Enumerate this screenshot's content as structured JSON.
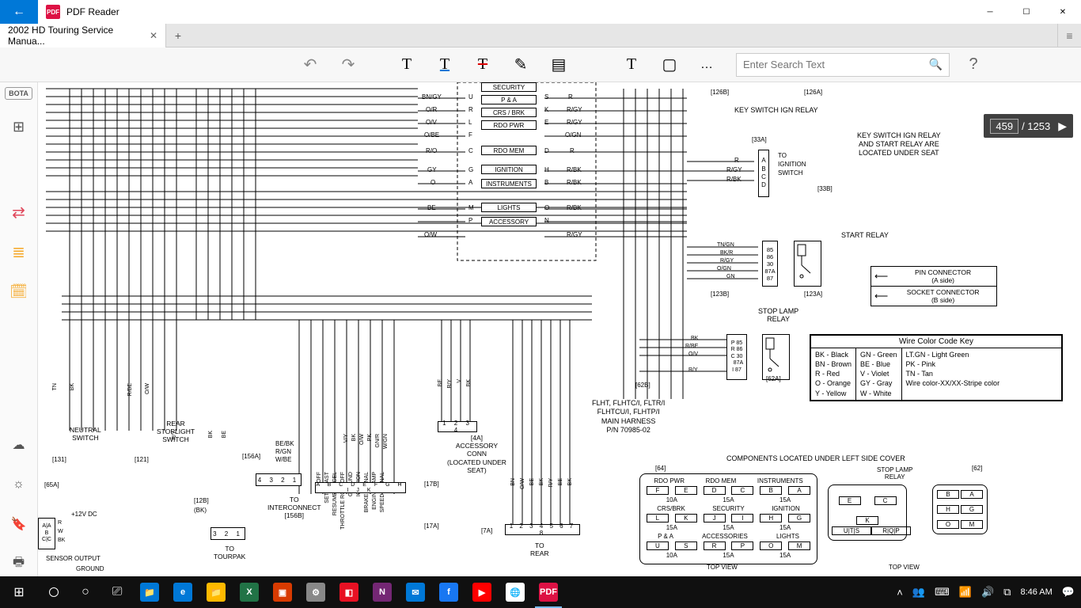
{
  "app": {
    "title": "PDF Reader",
    "back_arrow": "←"
  },
  "tabs": {
    "items": [
      {
        "label": "2002 HD Touring Service Manua..."
      }
    ],
    "close": "✕",
    "add": "+"
  },
  "toolbar": {
    "undo": "↶",
    "redo": "↷",
    "hl": "T",
    "ul": "T",
    "st": "T",
    "draw": "✎",
    "note": "▤",
    "bracket": "⎘",
    "type": "T",
    "case": "▢",
    "more": "…",
    "search_placeholder": "Enter Search Text",
    "help": "?"
  },
  "rail": {
    "bota": "BOTA",
    "grid": "⊞",
    "swap": "⇄",
    "stack": "≣",
    "sched": "🗓",
    "cloud": "☁",
    "sun": "☼",
    "book": "🔖",
    "print": "🖶"
  },
  "page": {
    "current": "459",
    "total": "1253",
    "arrow": "▶"
  },
  "diagram": {
    "fuses": {
      "security": "SECURITY",
      "pa": "P & A",
      "crsbrk": "CRS / BRK",
      "rdopwr": "RDO PWR",
      "rdomem": "RDO MEM",
      "ignition": "IGNITION",
      "instruments": "INSTRUMENTS",
      "lights": "LIGHTS",
      "accessory": "ACCESSORY"
    },
    "fuse_pins_left": [
      "U",
      "R",
      "L",
      "F",
      "C",
      "G",
      "A",
      "M",
      "P"
    ],
    "fuse_pins_right": [
      "S",
      "K",
      "E",
      "D",
      "H",
      "B",
      "O",
      "N"
    ],
    "wires_left": [
      "BN/GY",
      "O/R",
      "O/V",
      "O/BE",
      "R/O",
      "GY",
      "O",
      "BE",
      "O/W"
    ],
    "wires_right": [
      "R",
      "R/GY",
      "R/GY",
      "O/GN",
      "R",
      "R/BK",
      "R/BK",
      "R/BK",
      "R/GY"
    ],
    "conn_126b": "[126B]",
    "conn_126a": "[126A]",
    "key_switch_relay": "KEY SWITCH IGN RELAY",
    "key_switch_note": [
      "KEY SWITCH IGN RELAY",
      "AND START RELAY ARE",
      "LOCATED UNDER SEAT"
    ],
    "ign_switch": {
      "conn_33a": "[33A]",
      "conn_33b": "[33B]",
      "pins": [
        "A",
        "B",
        "C",
        "D"
      ],
      "to": "TO",
      "label": "IGNITION",
      "label2": "SWITCH",
      "wires": [
        "R",
        "R/GY",
        "R/BK"
      ]
    },
    "start_relay": {
      "title": "START RELAY",
      "pins": [
        "85",
        "86",
        "30",
        "87A",
        "87"
      ],
      "wires": [
        "TN/GN",
        "BK/R",
        "R/GY",
        "O/GN",
        "GN"
      ],
      "conn_b": "[123B]",
      "conn_a": "[123A]"
    },
    "stop_lamp_relay": {
      "title": "STOP LAMP",
      "title2": "RELAY",
      "pins": [
        "85",
        "86",
        "30",
        "87A",
        "87"
      ],
      "pin_letters": [
        "P",
        "R",
        "C",
        "",
        "I"
      ],
      "wires": [
        "BK",
        "R/BE",
        "O/V",
        "",
        "R/Y"
      ],
      "conn_b": "[62B]",
      "conn_a": "[62A]"
    },
    "harness": {
      "l1": "FLHT, FLHTC/I, FLTR/I",
      "l2": "FLHTCU/I, FLHTP/I",
      "l3": "MAIN HARNESS",
      "l4": "P/N 70985-02"
    },
    "pin_conn": {
      "l1": "PIN CONNECTOR",
      "l2": "(A side)"
    },
    "socket_conn": {
      "l1": "SOCKET CONNECTOR",
      "l2": "(B side)"
    },
    "colorkey": {
      "title": "Wire Color Code Key",
      "col1": [
        "BK - Black",
        "BN - Brown",
        "R - Red",
        "O - Orange",
        "Y - Yellow"
      ],
      "col2": [
        "GN - Green",
        "BE - Blue",
        "V - Violet",
        "GY - Gray",
        "W - White"
      ],
      "col3": [
        "LT.GN - Light Green",
        "PK - Pink",
        "TN - Tan",
        "Wire color-XX/XX-Stripe color"
      ]
    },
    "under_cover": "COMPONENTS LOCATED UNDER LEFT SIDE COVER",
    "fuseblock64": {
      "conn": "[64]",
      "r1_lbl": [
        "RDO PWR",
        "RDO MEM",
        "INSTRUMENTS"
      ],
      "r1": [
        "F",
        "E",
        "D",
        "C",
        "B",
        "A"
      ],
      "r1_amp": [
        "10A",
        "15A",
        "15A"
      ],
      "r2_lbl": [
        "CRS/BRK",
        "SECURITY",
        "IGNITION"
      ],
      "r2": [
        "L",
        "K",
        "J",
        "I",
        "H",
        "G"
      ],
      "r2_amp": [
        "15A",
        "15A",
        "15A"
      ],
      "r3_lbl": [
        "P & A",
        "ACCESSORIES",
        "LIGHTS"
      ],
      "r3": [
        "U",
        "S",
        "R",
        "P",
        "O",
        "M"
      ],
      "r3_amp": [
        "10A",
        "15A",
        "15A"
      ],
      "view": "TOP VIEW"
    },
    "fuseblock62": {
      "conn": "[62]",
      "title": "STOP LAMP",
      "title2": "RELAY",
      "r1": [
        "B",
        "A"
      ],
      "r2": [
        "E",
        "C"
      ],
      "r3": [
        "H",
        "G"
      ],
      "r4": [
        "K",
        "U|T|S",
        "R|Q|P"
      ],
      "r5": [
        "O",
        "M"
      ],
      "view": "TOP VIEW"
    },
    "neutral": {
      "l1": "NEUTRAL",
      "l2": "SWITCH",
      "conn": "[131]"
    },
    "rear_stop": {
      "l1": "REAR",
      "l2": "STOPLIGHT",
      "l3": "SWITCH",
      "conn": "[121]"
    },
    "neutral_wires": [
      "TN",
      "BK"
    ],
    "rear_stop_wires": [
      "R/BE",
      "O/W"
    ],
    "sensor": {
      "conn_65a": "[65A]",
      "twelve": "+12V DC",
      "pins": [
        "A|A",
        "B",
        "C|C"
      ],
      "pins2": [
        "R",
        "W",
        "BK"
      ],
      "out": "SENSOR OUTPUT",
      "gnd": "GROUND"
    },
    "interconnect": {
      "conn_156a": "[156A]",
      "pins": "4 3 2 1",
      "to": "TO",
      "label": "INTERCONNECT",
      "conn_156b": "[156B]",
      "wires": [
        "BE/BK",
        "R/GN",
        "W/BE"
      ],
      "side_wires": [
        "R/Y",
        "BK",
        "BE"
      ]
    },
    "tourpak": {
      "conn_12b": "[12B]",
      "bk": "(BK)",
      "pins": "3 2 1",
      "to": "TO",
      "label": "TOURPAK"
    },
    "vlabels_mid": [
      "ON/OFF",
      "SET/COAST",
      "RESUME/ACCEL",
      "THROTTLE ROLL OFF",
      "GROUND",
      "IGNITION",
      "BRAKE SIGNAL",
      "ENGINE LAMP",
      "SPEED SIGNAL"
    ],
    "vlabels_mid2": [
      "V/Y",
      "BK",
      "O/W",
      "PK",
      "GN/R",
      "W/GN"
    ],
    "mid_block_pins": "A B C D E F G H I J K",
    "accessory": {
      "wires": [
        "BE",
        "R/Y",
        "V",
        "BK"
      ],
      "pins": "1 2 3 4",
      "conn_4a": "[4A]",
      "l1": "ACCESSORY",
      "l2": "CONN",
      "note1": "(LOCATED UNDER",
      "note2": "SEAT)",
      "conn_17b": "[17B]",
      "conn_17a": "[17A]"
    },
    "rear_light": {
      "wires": [
        "BN",
        "O/W",
        "BE",
        "BK",
        "R/Y",
        "BE",
        "BK"
      ],
      "conn_7a": "[7A]",
      "pins": "1 2 3 4 5 6 7 8",
      "to": "TO",
      "label": "REAR"
    }
  },
  "taskbar": {
    "start": "⊞",
    "search": "🔍",
    "cortana": "○",
    "task": "⎚",
    "apps": [
      {
        "bg": "#0078d7",
        "g": "📁"
      },
      {
        "bg": "#0078d7",
        "g": "e"
      },
      {
        "bg": "#ffb900",
        "g": "📁"
      },
      {
        "bg": "#217346",
        "g": "X"
      },
      {
        "bg": "#d83b01",
        "g": "▣"
      },
      {
        "bg": "#888",
        "g": "⚙"
      },
      {
        "bg": "#e81123",
        "g": "◧"
      },
      {
        "bg": "#742774",
        "g": "N"
      },
      {
        "bg": "#0078d7",
        "g": "✉"
      },
      {
        "bg": "#1877f2",
        "g": "f"
      },
      {
        "bg": "#ff0000",
        "g": "▶"
      },
      {
        "bg": "#fff",
        "g": "🌐"
      },
      {
        "bg": "#d14",
        "g": "PDF"
      }
    ],
    "tray": {
      "up": "˄",
      "teams": "👥",
      "touch": "⌨",
      "wifi": "📶",
      "vol": "🔊",
      "lang": "⧉"
    },
    "time": "8:46 AM",
    "notif": "💬"
  }
}
